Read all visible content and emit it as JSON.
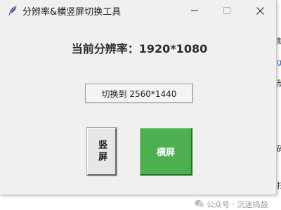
{
  "window": {
    "title": "分辨率&横竖屏切换工具"
  },
  "main": {
    "resolution_text": "当前分辨率：1920*1080",
    "switch_button_label": "切换到 2560*1440",
    "portrait_button_label": "竖屏",
    "landscape_button_label": "横屏"
  },
  "background": {
    "edge_glyphs": [
      "新",
      "g",
      "册",
      "码",
      "扫"
    ]
  },
  "watermark": {
    "text": "公众号 · 沉迷捣鼓"
  },
  "colors": {
    "window_bg": "#f0f0f0",
    "landscape_button_bg": "#4caf50",
    "portrait_button_bg": "#e6e6e6"
  },
  "icons": {
    "app": "feather-icon",
    "minimize": "minimize-icon",
    "maximize": "maximize-icon",
    "close": "close-icon",
    "watermark": "wechat-icon"
  }
}
